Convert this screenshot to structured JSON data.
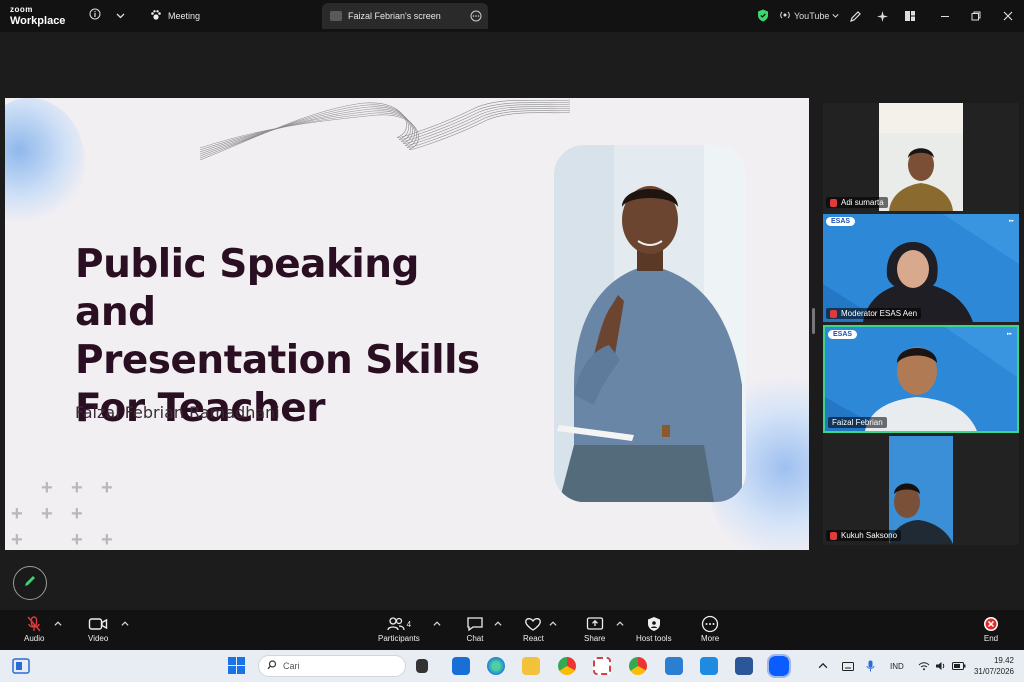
{
  "app": {
    "logo_line1": "zoom",
    "logo_line2": "Workplace",
    "meeting_tab": "Meeting",
    "share_tab": "Faizal Febrian's screen",
    "youtube_label": "YouTube"
  },
  "slide": {
    "title_line1": "Public Speaking and",
    "title_line2": "Presentation Skills",
    "title_line3": "For Teacher",
    "presenter": "Faizal Febrian Ramadhani"
  },
  "participants": [
    {
      "name": "Adi sumarta",
      "muted": true
    },
    {
      "name": "Moderator ESAS Aen",
      "muted": true
    },
    {
      "name": "Faizal Febrian",
      "muted": false
    },
    {
      "name": "Kukuh Saksono",
      "muted": true
    }
  ],
  "esas_badge": "ESAS",
  "toolbar": {
    "audio": "Audio",
    "video": "Video",
    "participants": "Participants",
    "participants_count": "4",
    "chat": "Chat",
    "react": "React",
    "share": "Share",
    "host_tools": "Host tools",
    "more": "More",
    "end": "End"
  },
  "taskbar": {
    "search_placeholder": "Cari",
    "lang": "IND",
    "time": "19.42",
    "date": "31/07/2026"
  },
  "colors": {
    "accent_green": "#3dd66b",
    "end_red": "#e02b2b",
    "title_color": "#2a0f22",
    "active_speaker_border": "#3bd68a"
  }
}
